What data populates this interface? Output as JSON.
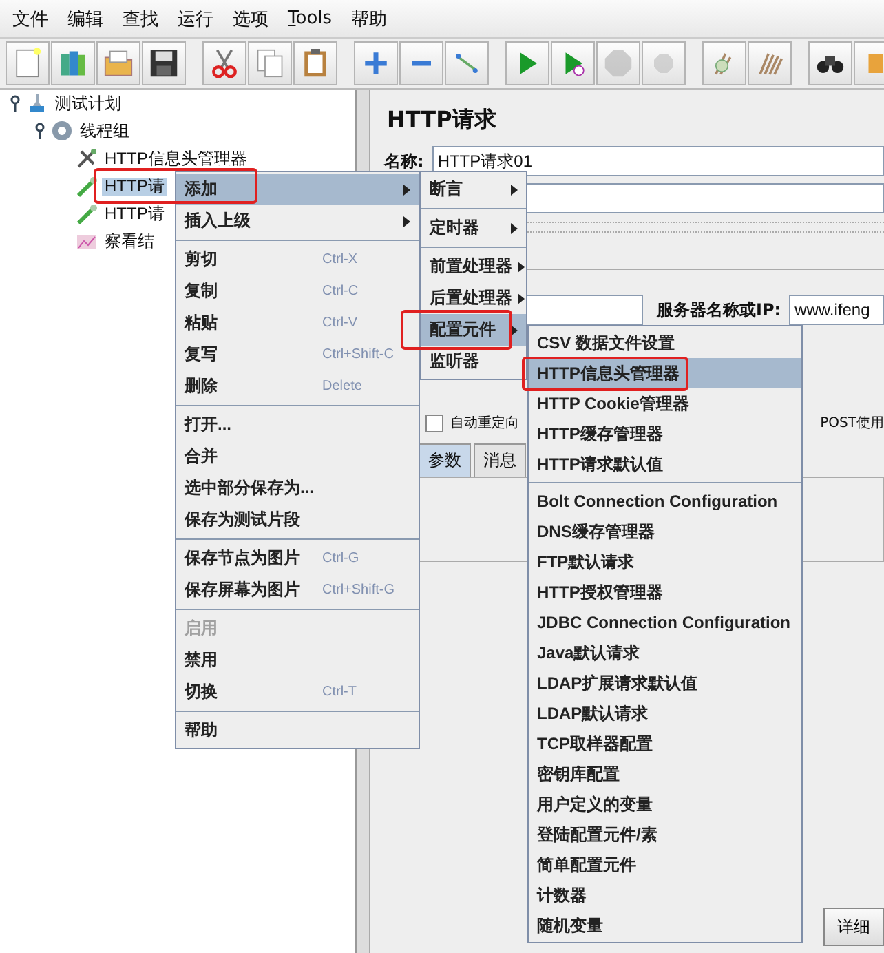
{
  "menu_bar": [
    {
      "label": "文件",
      "underline_first": false
    },
    {
      "label": "编辑",
      "underline_first": false
    },
    {
      "label": "查找",
      "underline_first": false
    },
    {
      "label": "运行",
      "underline_first": false
    },
    {
      "label": "选项",
      "underline_first": false
    },
    {
      "label": "Tools",
      "underline_first": true
    },
    {
      "label": "帮助",
      "underline_first": false
    }
  ],
  "toolbar": [
    [
      {
        "kind": "new",
        "disabled": false
      },
      {
        "kind": "templates",
        "disabled": false
      },
      {
        "kind": "open",
        "disabled": false
      },
      {
        "kind": "save",
        "disabled": false
      }
    ],
    [
      {
        "kind": "cut",
        "disabled": false
      },
      {
        "kind": "copy",
        "disabled": false
      },
      {
        "kind": "paste",
        "disabled": false
      }
    ],
    [
      {
        "kind": "expand",
        "disabled": false
      },
      {
        "kind": "collapse",
        "disabled": false
      },
      {
        "kind": "toggle",
        "disabled": false
      }
    ],
    [
      {
        "kind": "start",
        "disabled": false
      },
      {
        "kind": "start-no-pause",
        "disabled": false
      },
      {
        "kind": "stop",
        "disabled": true
      },
      {
        "kind": "shutdown",
        "disabled": true
      }
    ],
    [
      {
        "kind": "clear",
        "disabled": false
      },
      {
        "kind": "clear-all",
        "disabled": false
      }
    ],
    [
      {
        "kind": "search",
        "disabled": false
      },
      {
        "kind": "reset",
        "disabled": false
      }
    ]
  ],
  "tree": [
    {
      "label": "测试计划",
      "kind": "plan",
      "expanded": true,
      "selected": false,
      "children": [
        {
          "label": "线程组",
          "kind": "threads",
          "expanded": true,
          "selected": false,
          "children": [
            {
              "label": "HTTP信息头管理器",
              "kind": "config",
              "selected": false
            },
            {
              "label": "HTTP请",
              "kind": "sampler",
              "selected": true
            },
            {
              "label": "HTTP请",
              "kind": "sampler",
              "selected": false
            },
            {
              "label": "察看结",
              "kind": "listener",
              "selected": false
            }
          ]
        }
      ]
    }
  ],
  "panel": {
    "title": "HTTP请求",
    "name_label": "名称:",
    "name_value": "HTTP请求01",
    "server_label": "服务器名称或IP:",
    "server_value": "www.ifeng",
    "options": [
      {
        "label": "自动重定向",
        "checked": false
      }
    ],
    "post_text": "POST使用",
    "tabs": [
      {
        "label": "参数",
        "selected": true
      },
      {
        "label": "消息",
        "selected": false
      }
    ],
    "detail_button": "详细"
  },
  "context_menu": [
    {
      "kind": "item",
      "label": "添加",
      "submenu": true,
      "selected": true,
      "annotated": true
    },
    {
      "kind": "item",
      "label": "插入上级",
      "submenu": true,
      "selected": false
    },
    {
      "kind": "separator"
    },
    {
      "kind": "item",
      "label": "剪切",
      "shortcut": "Ctrl-X",
      "selected": false
    },
    {
      "kind": "item",
      "label": "复制",
      "shortcut": "Ctrl-C",
      "selected": false
    },
    {
      "kind": "item",
      "label": "粘贴",
      "shortcut": "Ctrl-V",
      "selected": false
    },
    {
      "kind": "item",
      "label": "复写",
      "shortcut": "Ctrl+Shift-C",
      "selected": false
    },
    {
      "kind": "item",
      "label": "删除",
      "shortcut": "Delete",
      "selected": false
    },
    {
      "kind": "separator"
    },
    {
      "kind": "item",
      "label": "打开...",
      "selected": false
    },
    {
      "kind": "item",
      "label": "合并",
      "selected": false
    },
    {
      "kind": "item",
      "label": "选中部分保存为...",
      "selected": false
    },
    {
      "kind": "item",
      "label": "保存为测试片段",
      "selected": false
    },
    {
      "kind": "separator"
    },
    {
      "kind": "item",
      "label": "保存节点为图片",
      "shortcut": "Ctrl-G",
      "selected": false
    },
    {
      "kind": "item",
      "label": "保存屏幕为图片",
      "shortcut": "Ctrl+Shift-G",
      "selected": false
    },
    {
      "kind": "separator"
    },
    {
      "kind": "item",
      "label": "启用",
      "selected": false,
      "disabled": true
    },
    {
      "kind": "item",
      "label": "禁用",
      "selected": false
    },
    {
      "kind": "item",
      "label": "切换",
      "shortcut": "Ctrl-T",
      "selected": false
    },
    {
      "kind": "separator"
    },
    {
      "kind": "item",
      "label": "帮助",
      "selected": false
    }
  ],
  "add_submenu": [
    {
      "kind": "item",
      "label": "断言",
      "submenu": true,
      "selected": false
    },
    {
      "kind": "separator"
    },
    {
      "kind": "item",
      "label": "定时器",
      "submenu": true,
      "selected": false
    },
    {
      "kind": "separator"
    },
    {
      "kind": "item",
      "label": "前置处理器",
      "submenu": true,
      "selected": false
    },
    {
      "kind": "item",
      "label": "后置处理器",
      "submenu": true,
      "selected": false
    },
    {
      "kind": "item",
      "label": "配置元件",
      "submenu": true,
      "selected": true,
      "annotated": true
    },
    {
      "kind": "item",
      "label": "监听器",
      "selected": false
    }
  ],
  "config_submenu": [
    {
      "kind": "item",
      "label": "CSV 数据文件设置",
      "selected": false
    },
    {
      "kind": "item",
      "label": "HTTP信息头管理器",
      "selected": true,
      "annotated": true
    },
    {
      "kind": "item",
      "label": "HTTP Cookie管理器",
      "selected": false
    },
    {
      "kind": "item",
      "label": "HTTP缓存管理器",
      "selected": false
    },
    {
      "kind": "item",
      "label": "HTTP请求默认值",
      "selected": false
    },
    {
      "kind": "separator"
    },
    {
      "kind": "item",
      "label": "Bolt Connection Configuration",
      "selected": false
    },
    {
      "kind": "item",
      "label": "DNS缓存管理器",
      "selected": false
    },
    {
      "kind": "item",
      "label": "FTP默认请求",
      "selected": false
    },
    {
      "kind": "item",
      "label": "HTTP授权管理器",
      "selected": false
    },
    {
      "kind": "item",
      "label": "JDBC Connection Configuration",
      "selected": false
    },
    {
      "kind": "item",
      "label": "Java默认请求",
      "selected": false
    },
    {
      "kind": "item",
      "label": "LDAP扩展请求默认值",
      "selected": false
    },
    {
      "kind": "item",
      "label": "LDAP默认请求",
      "selected": false
    },
    {
      "kind": "item",
      "label": "TCP取样器配置",
      "selected": false
    },
    {
      "kind": "item",
      "label": "密钥库配置",
      "selected": false
    },
    {
      "kind": "item",
      "label": "用户定义的变量",
      "selected": false
    },
    {
      "kind": "item",
      "label": "登陆配置元件/素",
      "selected": false
    },
    {
      "kind": "item",
      "label": "简单配置元件",
      "selected": false
    },
    {
      "kind": "item",
      "label": "计数器",
      "selected": false
    },
    {
      "kind": "item",
      "label": "随机变量",
      "selected": false
    }
  ]
}
